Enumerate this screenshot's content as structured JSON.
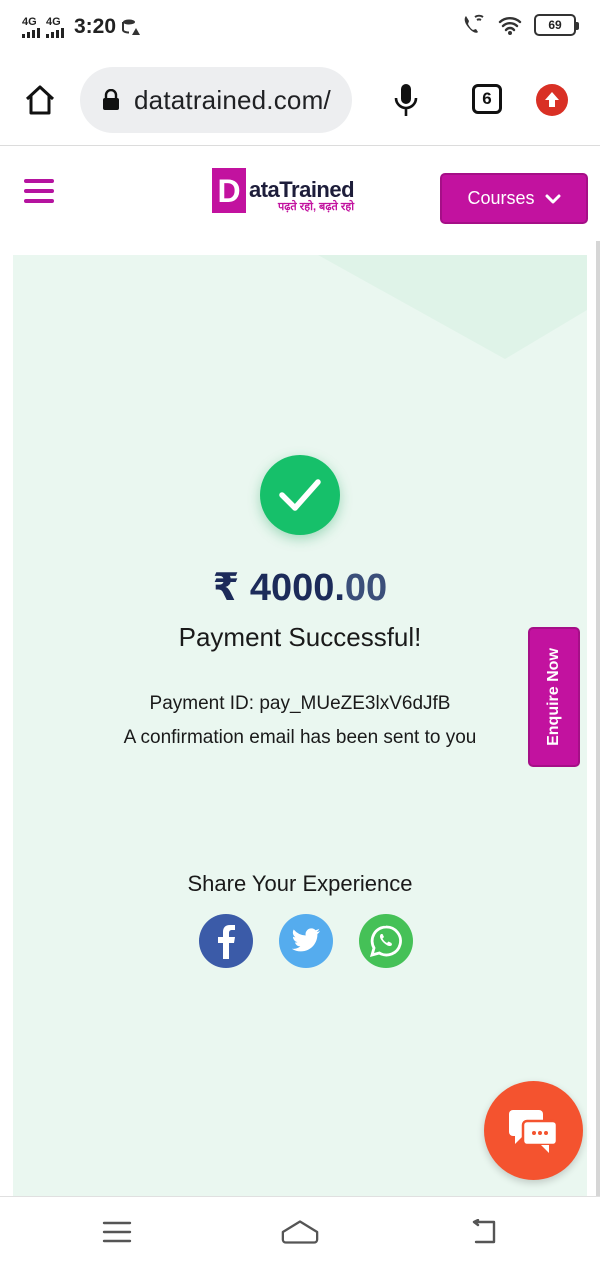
{
  "status_bar": {
    "signal_1_label": "4G",
    "signal_2_label": "4G",
    "time": "3:20",
    "battery": "69",
    "icons": [
      "data-saver-icon",
      "wifi-calling-icon",
      "wifi-icon",
      "battery-icon"
    ]
  },
  "browser": {
    "url": "datatrained.com/",
    "tab_count": "6",
    "icons": [
      "home-icon",
      "lock-icon",
      "mic-icon",
      "tabs-icon",
      "update-icon"
    ]
  },
  "site_header": {
    "logo_letter": "D",
    "logo_name": "ataTrained",
    "logo_tagline": "पढ़ते रहो, बढ़ते रहो",
    "courses_label": "Courses",
    "icons": [
      "menu-icon",
      "chevron-down-icon"
    ]
  },
  "payment": {
    "currency_symbol": "₹",
    "amount_whole": "4000.",
    "amount_decimal": "00",
    "title": "Payment Successful!",
    "payment_id": "Payment ID: pay_MUeZE3lxV6dJfB",
    "note": "A confirmation email has been sent to you",
    "icon": "check-icon"
  },
  "share": {
    "title": "Share Your Experience",
    "icons": [
      "facebook-icon",
      "twitter-icon",
      "whatsapp-icon"
    ]
  },
  "enquire_label": "Enquire Now",
  "chat": {
    "icon": "chat-icon"
  },
  "nav_bar": {
    "icons": [
      "recents-icon",
      "home-nav-icon",
      "back-icon"
    ]
  },
  "colors": {
    "brand": "#c2129f",
    "success": "#16c06a",
    "card_bg": "#eaf7f0",
    "amount": "#1c2b5a",
    "chat_fab": "#f4532f",
    "facebook": "#3b5ba8",
    "twitter": "#55acee",
    "whatsapp": "#45c157"
  }
}
